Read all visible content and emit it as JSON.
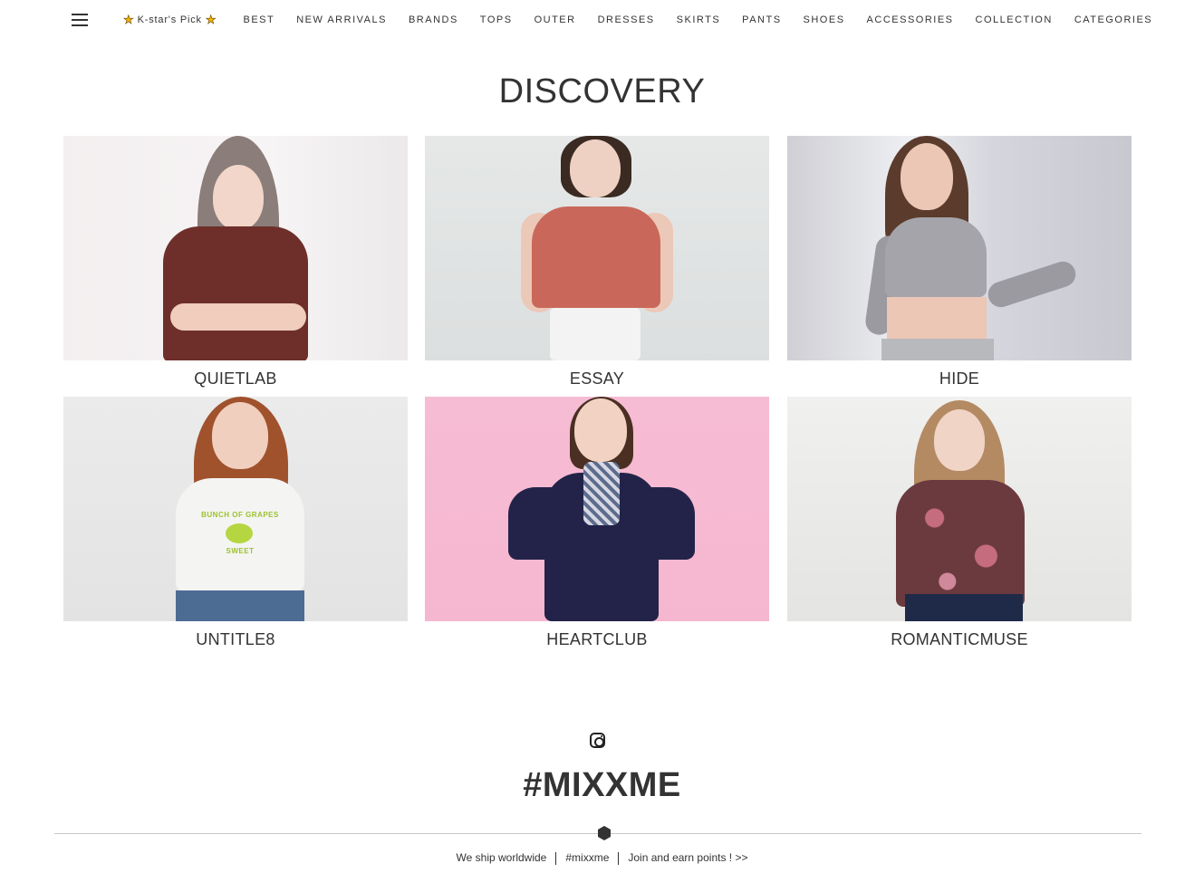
{
  "nav": {
    "pick_label": "K-star's Pick",
    "items": [
      "BEST",
      "NEW ARRIVALS",
      "BRANDS",
      "TOPS",
      "OUTER",
      "DRESSES",
      "SKIRTS",
      "PANTS",
      "SHOES",
      "ACCESSORIES",
      "COLLECTION",
      "CATEGORIES"
    ]
  },
  "discovery": {
    "title": "DISCOVERY",
    "brands": [
      {
        "name": "QUIETLAB",
        "image": "woman in fitted rust-brown tee, long grey-brown hair, arms crossed"
      },
      {
        "name": "ESSAY",
        "image": "woman in coral puff-sleeve top and white pants, short bob"
      },
      {
        "name": "HIDE",
        "image": "woman in grey ribbed long-sleeve tie-front crop top"
      },
      {
        "name": "UNTITLE8",
        "image": "woman in white graphic tee 'BUNCH OF GRAPES SWEET' and denim"
      },
      {
        "name": "HEARTCLUB",
        "image": "smiling girl in navy dress with striped scarf on pink background"
      },
      {
        "name": "ROMANTICMUSE",
        "image": "woman in floral pink ruffle blouse and navy skirt"
      }
    ],
    "tee_print": {
      "line1": "BUNCH OF GRAPES",
      "line2": "SWEET"
    }
  },
  "instagram": {
    "icon": "instagram-icon",
    "hashtag": "#MIXXME"
  },
  "footer": {
    "links": [
      "We ship worldwide",
      "#mixxme",
      "Join and earn points ! >>"
    ]
  },
  "colors": {
    "text": "#333333",
    "star": "#f5b400",
    "divider": "#c8c8c8"
  }
}
